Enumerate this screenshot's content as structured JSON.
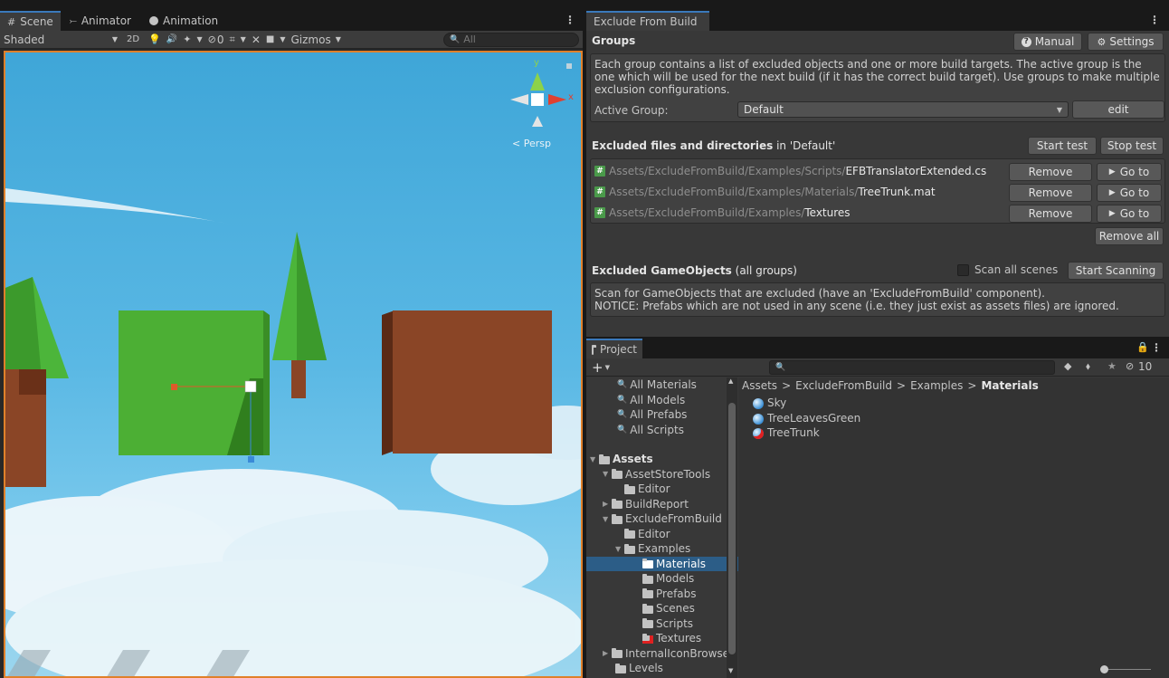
{
  "scene": {
    "tabs": [
      {
        "label": "Scene",
        "icon": "hash-icon"
      },
      {
        "label": "Animator",
        "icon": "animator-icon"
      },
      {
        "label": "Animation",
        "icon": "animation-icon"
      }
    ],
    "shading_mode": "Shaded",
    "toggle_2d": "2D",
    "hidden_count": "0",
    "gizmos_label": "Gizmos",
    "search_placeholder": "All",
    "gizmo_y": "y",
    "gizmo_x": "x",
    "persp_label": "Persp"
  },
  "efb": {
    "tab": "Exclude From Build",
    "groups_title": "Groups",
    "manual_button": "Manual",
    "settings_button": "Settings",
    "description": "Each group contains a list of excluded objects and one or more build targets. The active group is the one which will be used for the next build (if it has the correct build target). Use groups to make multiple exclusion configurations.",
    "active_group_label": "Active Group:",
    "active_group_value": "Default",
    "edit_button": "edit",
    "excluded_title": "Excluded files and directories",
    "excluded_suffix": " in 'Default'",
    "start_test": "Start test",
    "stop_test": "Stop test",
    "files": [
      {
        "path": "Assets/ExcludeFromBuild/Examples/Scripts/",
        "name": "EFBTranslatorExtended.cs",
        "remove": "Remove",
        "goto": "Go to"
      },
      {
        "path": "Assets/ExcludeFromBuild/Examples/Materials/",
        "name": "TreeTrunk.mat",
        "remove": "Remove",
        "goto": "Go to"
      },
      {
        "path": "Assets/ExcludeFromBuild/Examples/",
        "name": "Textures",
        "remove": "Remove",
        "goto": "Go to"
      }
    ],
    "remove_all": "Remove all",
    "gameobjects_title": "Excluded GameObjects",
    "gameobjects_suffix": " (all groups)",
    "scan_all_scenes": "Scan all scenes",
    "start_scanning": "Start Scanning",
    "scan_text_1": "Scan for GameObjects that are excluded (have an 'ExcludeFromBuild' component).",
    "scan_text_2": "NOTICE: Prefabs which are not used in any scene (i.e. they just exist as assets files) are ignored."
  },
  "project": {
    "tab": "Project",
    "plus_label": "+",
    "hidden_count": "10",
    "favorites": [
      "All Materials",
      "All Models",
      "All Prefabs",
      "All Scripts"
    ],
    "tree": [
      {
        "label": "Assets",
        "depth": 0,
        "expanded": true,
        "bold": true
      },
      {
        "label": "AssetStoreTools",
        "depth": 1,
        "expanded": true
      },
      {
        "label": "Editor",
        "depth": 2
      },
      {
        "label": "BuildReport",
        "depth": 1,
        "collapsed": true
      },
      {
        "label": "ExcludeFromBuild",
        "depth": 1,
        "expanded": true
      },
      {
        "label": "Editor",
        "depth": 2
      },
      {
        "label": "Examples",
        "depth": 2,
        "expanded": true
      },
      {
        "label": "Materials",
        "depth": 3,
        "selected": true
      },
      {
        "label": "Models",
        "depth": 3
      },
      {
        "label": "Prefabs",
        "depth": 3
      },
      {
        "label": "Scenes",
        "depth": 3
      },
      {
        "label": "Scripts",
        "depth": 3
      },
      {
        "label": "Textures",
        "depth": 3,
        "excluded": true
      },
      {
        "label": "InternalIconBrowser",
        "depth": 1,
        "collapsed": true
      },
      {
        "label": "Levels",
        "depth": 1
      }
    ],
    "breadcrumb": [
      "Assets",
      "ExcludeFromBuild",
      "Examples",
      "Materials"
    ],
    "breadcrumb_sep": ">",
    "items": [
      {
        "label": "Sky",
        "excluded": false
      },
      {
        "label": "TreeLeavesGreen",
        "excluded": false
      },
      {
        "label": "TreeTrunk",
        "excluded": true
      }
    ]
  }
}
